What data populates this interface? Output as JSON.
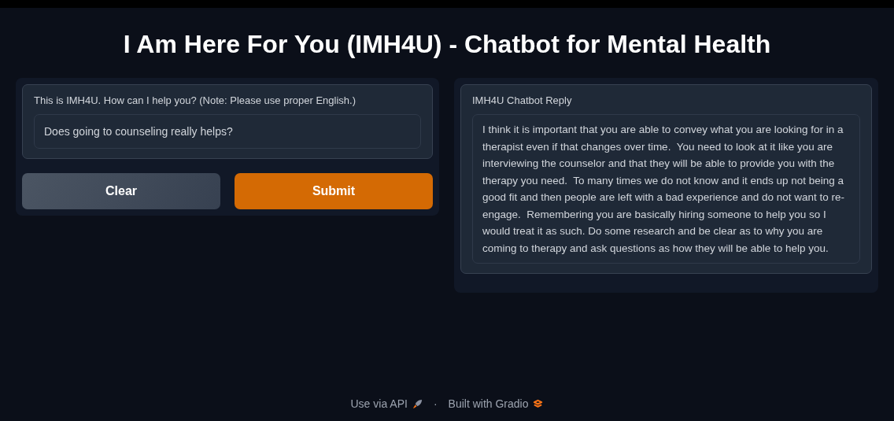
{
  "title": "I Am Here For You (IMH4U) - Chatbot for Mental Health",
  "input": {
    "label": "This is IMH4U. How can I help you? (Note: Please use proper English.)",
    "value": "Does going to counseling really helps?"
  },
  "buttons": [
    {
      "label": "Clear",
      "kind": "secondary"
    },
    {
      "label": "Submit",
      "kind": "primary"
    }
  ],
  "output": {
    "label": "IMH4U Chatbot Reply",
    "value": "I think it is important that you are able to convey what you are looking for in a therapist even if that changes over time.  You need to look at it like you are interviewing the counselor and that they will be able to provide you with the therapy you need.  To many times we do not know and it ends up not being a good fit and then people are left with a bad experience and do not want to re-engage.  Remembering you are basically hiring someone to help you so I would treat it as such. Do some research and be clear as to why you are coming to therapy and ask questions as how they will be able to help you."
  },
  "footer": {
    "api_link": "Use via API",
    "separator": "·",
    "built_with": "Built with Gradio"
  }
}
